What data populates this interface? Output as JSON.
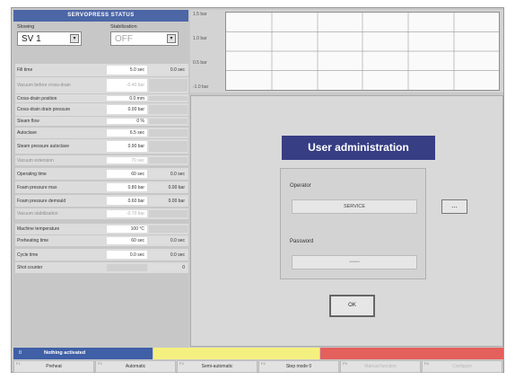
{
  "left": {
    "title": "SERVOPRESS STATUS",
    "selectors": [
      {
        "label": "Slowing",
        "value": "SV 1",
        "disabled": false
      },
      {
        "label": "Stabilization",
        "value": "OFF",
        "disabled": true
      }
    ],
    "rows": [
      {
        "label": "Fill time",
        "v1": "5.0 sec",
        "v2": "0.0 sec",
        "dim": false,
        "v2empty": false
      },
      {
        "label": "Vacuum before cross-drain",
        "v1": "-0.40 bar",
        "v2": "",
        "dim": true,
        "v2empty": true
      },
      {
        "label": "Cross-drain position",
        "v1": "0.0 mm",
        "v2": "",
        "dim": false,
        "v2empty": true
      },
      {
        "label": "Cross-drain drain pressure",
        "v1": "0.00 bar",
        "v2": "",
        "dim": false,
        "v2empty": true
      },
      {
        "label": "Steam flow",
        "v1": "0 %",
        "v2": "",
        "dim": false,
        "v2empty": true
      },
      {
        "label": "Autoclave",
        "v1": "6.5 sec",
        "v2": "",
        "dim": false,
        "v2empty": true
      },
      {
        "label": "Steam pressure autoclave",
        "v1": "0.90 bar",
        "v2": "",
        "dim": false,
        "v2empty": true
      },
      {
        "label": "Vacuum extension",
        "v1": "70 sec",
        "v2": "",
        "dim": true,
        "v2empty": true
      },
      {
        "label": "Operating time",
        "v1": "60 sec",
        "v2": "0.0 sec",
        "dim": false,
        "v2empty": false
      },
      {
        "label": "Foam pressure max",
        "v1": "0.80 bar",
        "v2": "0.00 bar",
        "dim": false,
        "v2empty": false
      },
      {
        "label": "Foam pressure demould",
        "v1": "0.60 bar",
        "v2": "0.00 bar",
        "dim": false,
        "v2empty": false
      },
      {
        "label": "Vacuum stabilization",
        "v1": "-0.70 bar",
        "v2": "",
        "dim": true,
        "v2empty": true
      },
      {
        "label": "Machine temperature",
        "v1": "100 °C",
        "v2": "",
        "dim": false,
        "v2empty": true
      },
      {
        "label": "Preheating time",
        "v1": "60 sec",
        "v2": "0.0 sec",
        "dim": false,
        "v2empty": false
      },
      {
        "label": "Cycle time",
        "v1": "0.0 sec",
        "v2": "0.0 sec",
        "dim": false,
        "v2empty": false
      },
      {
        "label": "Shot counter",
        "v1": "",
        "v2": "0",
        "dim": false,
        "v2empty": false
      }
    ]
  },
  "graph": {
    "ylabels": [
      "1.5 bar",
      "1.0 bar",
      "0.5 bar",
      "-1.0 bar"
    ]
  },
  "dialog": {
    "title": "User administration",
    "operator_label": "Operator",
    "operator_value": "SERVICE",
    "password_label": "Password",
    "password_value": "••••••",
    "ellipsis": "...",
    "ok": "OK"
  },
  "status": {
    "number": "0",
    "text": "Nothing activated",
    "colors": {
      "blue": "#3f5fa6",
      "yellow": "#f4f080",
      "red": "#e4605c"
    }
  },
  "buttons": [
    {
      "key": "F1",
      "label": "Preheat",
      "dim": false
    },
    {
      "key": "F2",
      "label": "Automatic",
      "dim": false
    },
    {
      "key": "F3",
      "label": "Semi-automatic",
      "dim": false
    },
    {
      "key": "F4",
      "label": "Step mode 0",
      "dim": false
    },
    {
      "key": "F5",
      "label": "Manual function",
      "dim": true
    },
    {
      "key": "F6",
      "label": "Configure",
      "dim": true
    }
  ]
}
